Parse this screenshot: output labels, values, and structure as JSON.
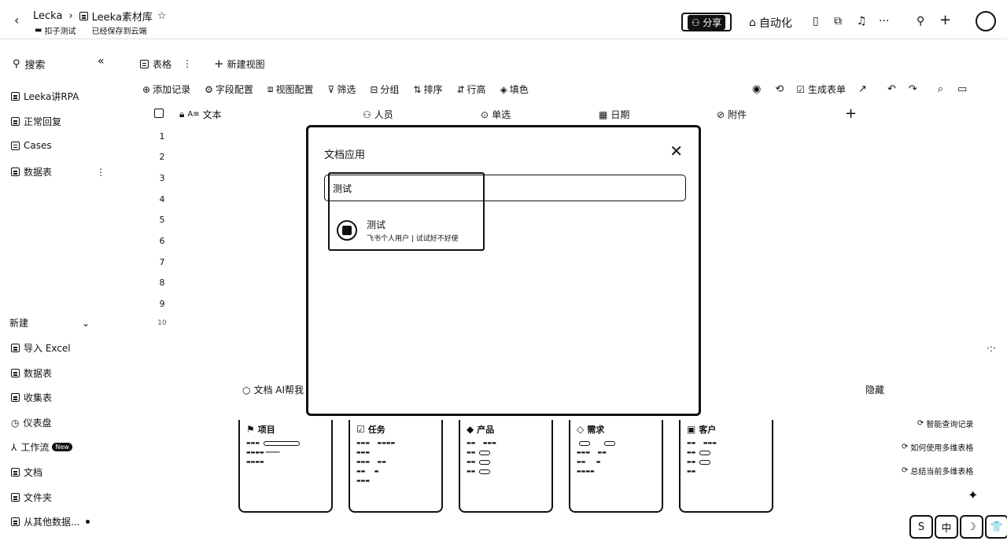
{
  "header": {
    "doc_name": "Lecka",
    "base_name": "Leeka素材库",
    "folder": "扣子测试",
    "save_status": "已经保存到云端",
    "share_label": "分享",
    "automation_label": "自动化"
  },
  "sidebar": {
    "search_label": "搜索",
    "tables": [
      {
        "label": "Leeka讲RPA"
      },
      {
        "label": "正常回复"
      },
      {
        "label": "Cases"
      },
      {
        "label": "数据表"
      }
    ],
    "new_section_label": "新建",
    "new_items": [
      {
        "label": "导入 Excel"
      },
      {
        "label": "数据表"
      },
      {
        "label": "收集表"
      },
      {
        "label": "仪表盘"
      },
      {
        "label": "工作流",
        "badge": "New"
      },
      {
        "label": "文档"
      },
      {
        "label": "文件夹"
      },
      {
        "label": "从其他数据..."
      }
    ]
  },
  "view_tabs": {
    "current": "表格",
    "new_view": "新建视图"
  },
  "toolbar": {
    "add_record": "添加记录",
    "field_config": "字段配置",
    "view_config": "视图配置",
    "filter": "筛选",
    "group": "分组",
    "sort": "排序",
    "row_height": "行高",
    "fill_color": "填色",
    "generate_form": "生成表单"
  },
  "columns": [
    {
      "label": "文本"
    },
    {
      "label": "人员"
    },
    {
      "label": "单选"
    },
    {
      "label": "日期"
    },
    {
      "label": "附件"
    }
  ],
  "row_numbers": [
    "1",
    "2",
    "3",
    "4",
    "5",
    "6",
    "7",
    "8",
    "9",
    "10"
  ],
  "modal": {
    "title": "文档应用",
    "search_value": "测试",
    "result": {
      "name": "测试",
      "description": "飞书个人用户 | 试试好不好使"
    }
  },
  "ai_help": {
    "label": "文档 AI帮我",
    "hide_label": "隐藏"
  },
  "templates": [
    {
      "name": "项目"
    },
    {
      "name": "任务"
    },
    {
      "name": "产品"
    },
    {
      "name": "需求"
    },
    {
      "name": "客户"
    }
  ],
  "ai_suggestions": [
    "智能查询记录",
    "如何使用多维表格",
    "总结当前多维表格"
  ],
  "bottom_tools": [
    "S",
    "中",
    "☽",
    "👕"
  ]
}
